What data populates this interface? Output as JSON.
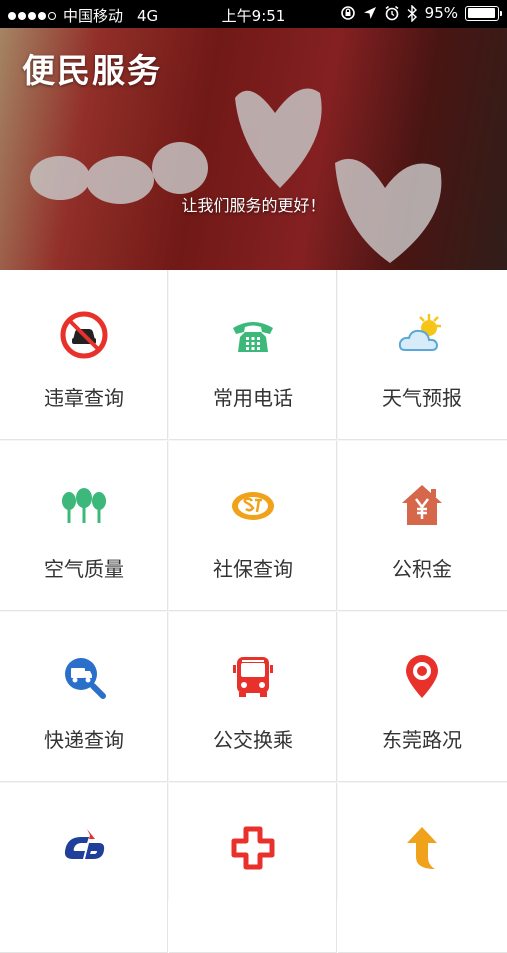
{
  "status_bar": {
    "carrier": "中国移动",
    "network": "4G",
    "time": "上午9:51",
    "battery": "95%",
    "battery_level": 0.95
  },
  "banner": {
    "title": "便民服务",
    "subtitle": "让我们服务的更好！"
  },
  "services": [
    {
      "label": "违章查询",
      "icon": "no-car-icon"
    },
    {
      "label": "常用电话",
      "icon": "telephone-icon"
    },
    {
      "label": "天气预报",
      "icon": "weather-icon"
    },
    {
      "label": "空气质量",
      "icon": "trees-icon"
    },
    {
      "label": "社保查询",
      "icon": "social-security-icon"
    },
    {
      "label": "公积金",
      "icon": "house-yuan-icon"
    },
    {
      "label": "快递查询",
      "icon": "delivery-search-icon"
    },
    {
      "label": "公交换乘",
      "icon": "bus-icon"
    },
    {
      "label": "东莞路况",
      "icon": "map-pin-icon"
    },
    {
      "label": "",
      "icon": "bank-logo-icon"
    },
    {
      "label": "",
      "icon": "medical-cross-icon"
    },
    {
      "label": "",
      "icon": "up-arrow-icon"
    }
  ],
  "colors": {
    "red": "#e8312b",
    "green": "#3bb87a",
    "blue": "#2a6fc9",
    "orange": "#f0a21a",
    "brown": "#d5674a"
  }
}
